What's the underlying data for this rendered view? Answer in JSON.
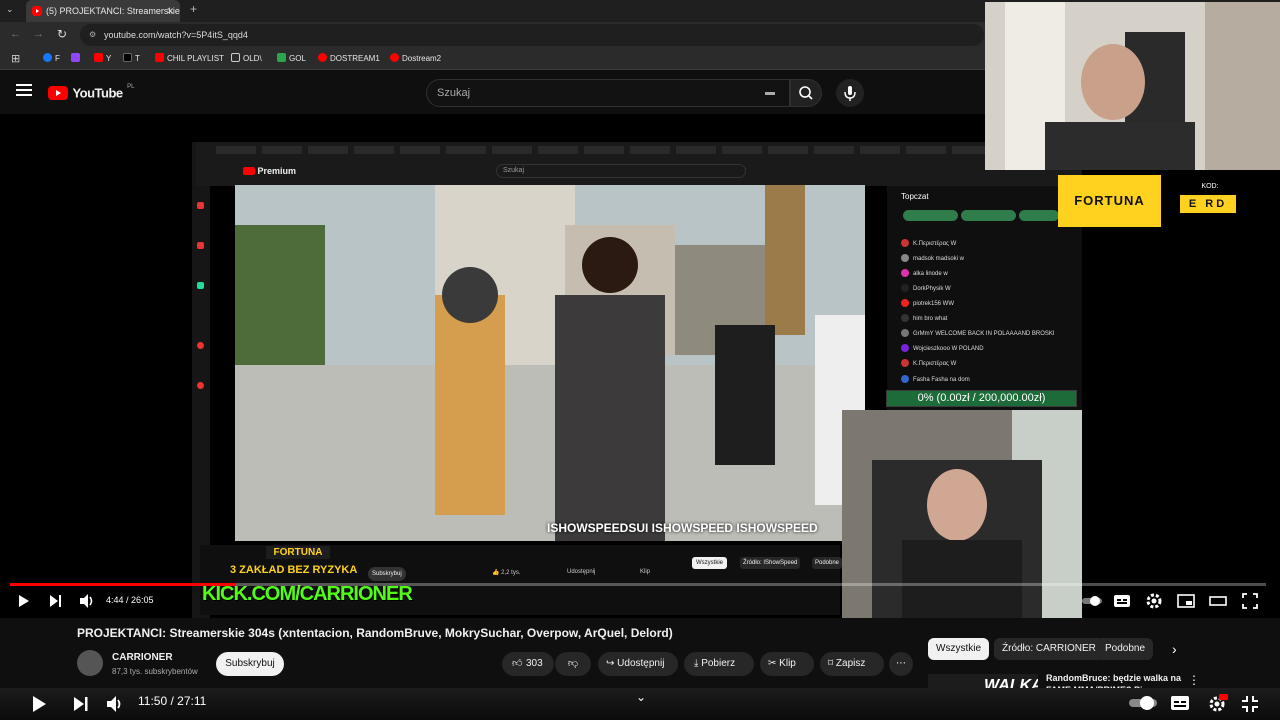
{
  "browser": {
    "tab_title": "(5) PROJEKTANCI: Streamerskie",
    "url": "youtube.com/watch?v=5P4itS_qqd4",
    "bookmarks": [
      "F",
      "Y",
      "T",
      "CHIL PLAYLIST",
      "OLD\\",
      "GOL",
      "DOSTREAM1",
      "Dostream2"
    ]
  },
  "youtube": {
    "logo_text": "YouTube",
    "region": "PL",
    "search_placeholder": "Szukaj"
  },
  "stream": {
    "inner_logo": "Premium",
    "inner_search": "Szukaj",
    "topchat_label": "Topczat",
    "chat_lines": [
      "K.Περιστέρας W",
      "madsok madsoki w",
      "alka linode w",
      "DorkPhysik W",
      "piotrek156 WW",
      "him bro what",
      "GrMmY WELCOME BACK IN POLAAAAND BROSKI",
      "Wojcieszkooo W POLAND",
      "K.Περιστέρας W",
      "Fasha Fasha na dom"
    ],
    "goal_text": "0% (0.00zł / 200,000.00zł)",
    "overlay_handles": "ISHOWSPEEDSUI  ISHOWSPEED  ISHOWSPEED",
    "fortuna_label": "FORTUNA",
    "kod_label": "KOD:",
    "kod_value": "E RD",
    "banner_fortuna": "FORTUNA",
    "banner_promo": "3 ZAKŁAD BEZ RYZYKA",
    "kick_text": "KICK.COM/CARRIONER",
    "inner_likes": "2,2 tys.",
    "inner_share": "Udostępnij",
    "inner_clip": "Klip",
    "inner_chip_all": "Wszystkie",
    "inner_chip_source": "Źródło: IShowSpeed",
    "inner_chip_similar": "Podobne",
    "inner_subscribe": "Subskrybuj"
  },
  "player": {
    "time": "4:44 / 26:05",
    "progress_fraction": 0.18
  },
  "video": {
    "title": "PROJEKTANCI: Streamerskie 304s (xntentacion, RandomBruve, MokrySuchar, Overpow, ArQuel, Delord)",
    "channel": "CARRIONER",
    "subscribers": "87,3 tys. subskrybentów",
    "subscribe_label": "Subskrybuj",
    "likes": "303",
    "share": "Udostępnij",
    "download": "Pobierz",
    "clip": "Klip",
    "save": "Zapisz"
  },
  "chips": [
    "Wszystkie",
    "Źródło: CARRIONER",
    "Podobne"
  ],
  "recommended": {
    "thumb_text": "WALKA",
    "title": "RandomBruce: będzie walka na FAME MMA/PRIME? Pierwsze"
  },
  "outer": {
    "time": "11:50 / 27:11"
  },
  "colors": {
    "red": "#ff0000",
    "fortuna_yellow": "#ffd21f",
    "kick_green": "#53fc18"
  }
}
